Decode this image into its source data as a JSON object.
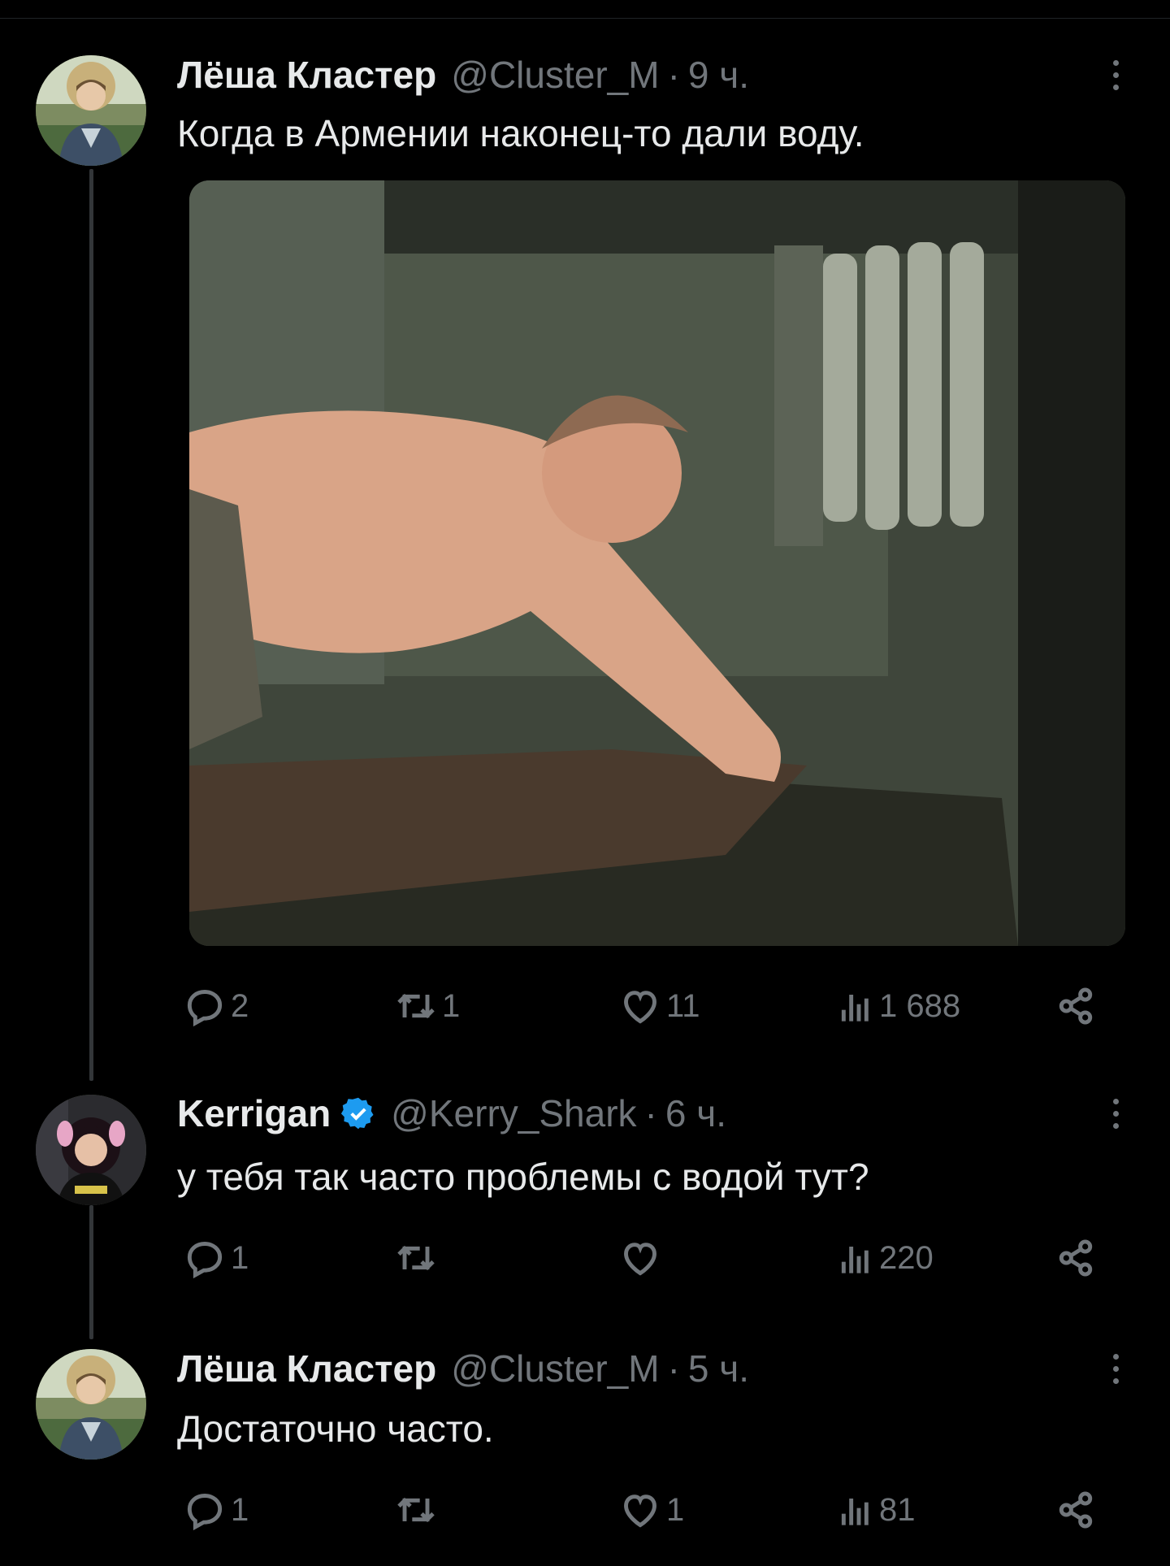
{
  "tweets": [
    {
      "name": "Лёша Кластер",
      "handle": "@Cluster_M",
      "separator": "·",
      "time": "9 ч.",
      "text": "Когда в Армении наконец-то дали воду.",
      "replies": "2",
      "retweets": "1",
      "likes": "11",
      "views": "1 688"
    },
    {
      "name": "Kerrigan",
      "handle": "@Kerry_Shark",
      "separator": "·",
      "time": "6 ч.",
      "text": "у тебя так часто проблемы с водой тут?",
      "replies": "1",
      "retweets": "",
      "likes": "",
      "views": "220"
    },
    {
      "name": "Лёша Кластер",
      "handle": "@Cluster_M",
      "separator": "·",
      "time": "5 ч.",
      "text": "Достаточно часто.",
      "replies": "1",
      "retweets": "",
      "likes": "1",
      "views": "81"
    }
  ],
  "colors": {
    "background": "#000000",
    "text": "#e7e9ea",
    "muted": "#71767b",
    "verified": "#1d9bf0",
    "thread_line": "#333639"
  },
  "icons": [
    "reply-icon",
    "retweet-icon",
    "like-icon",
    "views-icon",
    "share-icon",
    "more-icon",
    "verified-icon"
  ]
}
